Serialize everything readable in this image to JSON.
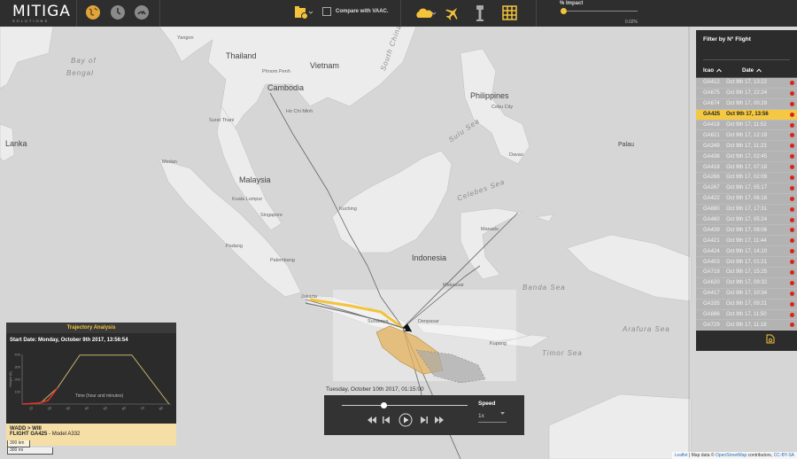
{
  "app": {
    "name": "MITIGA",
    "subtitle": "SOLUTIONS"
  },
  "toolbar": {
    "icons": [
      "globe-icon",
      "clock-icon",
      "gauge-icon",
      "volcano-layer-icon",
      "cloud-icon",
      "airplane-icon",
      "tower-icon",
      "grid-icon"
    ],
    "compare_label": "Compare with VAAC.",
    "impact_label": "% Impact",
    "impact_value": "0.02%",
    "impact_fraction": 0.0002
  },
  "map": {
    "countries": [
      "Thailand",
      "Vietnam",
      "Cambodia",
      "Philippines",
      "Malaysia",
      "Indonesia",
      "Lanka",
      "Palau"
    ],
    "seas": [
      "Bay of",
      "Bengal",
      "South China Sea",
      "Sulu Sea",
      "Celebes Sea",
      "Banda Sea",
      "Arafura Sea",
      "Timor Sea"
    ],
    "cities": [
      "Yangon",
      "Surat Thani",
      "Kuala Lumpur",
      "Singapore",
      "Palembang",
      "Jakarta",
      "Surabaya",
      "Denpasar",
      "Makassar",
      "Kupang",
      "Manado",
      "Kuching",
      "Ho Chi Minh",
      "Phnom Penh",
      "Medan",
      "Padang",
      "Cebu City",
      "Davao"
    ],
    "scale_km": "300 km",
    "scale_mi": "300 mi",
    "attribution_leaflet": "Leaflet",
    "attribution_text": " | Map data © ",
    "attribution_osm": "OpenStreetMap",
    "attribution_contrib": " contributors, ",
    "attribution_license": "CC-BY-SA"
  },
  "flight_panel": {
    "title": "Filter by N° Flight",
    "col_icao": "Icao",
    "col_date": "Date",
    "sort_icon": "chevron-up-icon",
    "rows": [
      {
        "icao": "GA412",
        "date": "Oct 9th 17, 13:22",
        "active": false
      },
      {
        "icao": "GA675",
        "date": "Oct 9th 17, 22:24",
        "active": false
      },
      {
        "icao": "GA674",
        "date": "Oct 9th 17, 00:29",
        "active": false
      },
      {
        "icao": "GA425",
        "date": "Oct 9th 17, 13:56",
        "active": true
      },
      {
        "icao": "GA418",
        "date": "Oct 9th 17, 11:52",
        "active": false
      },
      {
        "icao": "GA621",
        "date": "Oct 9th 17, 12:19",
        "active": false
      },
      {
        "icao": "GA349",
        "date": "Oct 9th 17, 11:23",
        "active": false
      },
      {
        "icao": "GA438",
        "date": "Oct 9th 17, 02:45",
        "active": false
      },
      {
        "icao": "GA418",
        "date": "Oct 9th 17, 07:18",
        "active": false
      },
      {
        "icao": "GA266",
        "date": "Oct 9th 17, 02:09",
        "active": false
      },
      {
        "icao": "GA267",
        "date": "Oct 9th 17, 05:17",
        "active": false
      },
      {
        "icao": "GA422",
        "date": "Oct 9th 17, 06:18",
        "active": false
      },
      {
        "icao": "GA880",
        "date": "Oct 9th 17, 17:31",
        "active": false
      },
      {
        "icao": "GA460",
        "date": "Oct 9th 17, 05:24",
        "active": false
      },
      {
        "icao": "GA439",
        "date": "Oct 9th 17, 08:06",
        "active": false
      },
      {
        "icao": "GA421",
        "date": "Oct 9th 17, 11:44",
        "active": false
      },
      {
        "icao": "GA424",
        "date": "Oct 9th 17, 14:10",
        "active": false
      },
      {
        "icao": "GA403",
        "date": "Oct 9th 17, 01:21",
        "active": false
      },
      {
        "icao": "GA718",
        "date": "Oct 9th 17, 15:25",
        "active": false
      },
      {
        "icao": "GA620",
        "date": "Oct 9th 17, 09:32",
        "active": false
      },
      {
        "icao": "GA417",
        "date": "Oct 9th 17, 10:34",
        "active": false
      },
      {
        "icao": "GA335",
        "date": "Oct 9th 17, 09:21",
        "active": false
      },
      {
        "icao": "GA886",
        "date": "Oct 9th 17, 11:50",
        "active": false
      },
      {
        "icao": "GA729",
        "date": "Oct 9th 17, 11:18",
        "active": false
      }
    ]
  },
  "trajectory": {
    "title": "Trajectory Analysis",
    "start_date": "Start Date: Monday, October 9th 2017, 13:56:54",
    "xlabel": "Time (hour and minutes)",
    "ylabel": "Height (ft)",
    "route": "WADD > WIII",
    "flight_prefix": "FLIGHT ",
    "flight_code": "GA425",
    "flight_model": " - Model A332"
  },
  "chart_data": {
    "type": "line",
    "title": "",
    "xlabel": "Time (hour and minutes)",
    "ylabel": "Height (ft)",
    "y_ticks": [
      "400",
      "300",
      "200",
      "100"
    ],
    "x_ticks": [
      "10",
      "20",
      "30",
      "40",
      "50",
      "60",
      "70",
      "80"
    ],
    "ylim": [
      0,
      400
    ],
    "xlim": [
      5,
      85
    ],
    "series": [
      {
        "color": "#c8b56a",
        "points": [
          [
            5,
            0
          ],
          [
            15,
            10
          ],
          [
            24,
            130
          ],
          [
            36,
            395
          ],
          [
            64,
            395
          ],
          [
            84,
            0
          ]
        ]
      },
      {
        "color": "#e0332a",
        "points": [
          [
            5,
            0
          ],
          [
            14,
            8
          ],
          [
            19,
            30
          ],
          [
            24,
            130
          ]
        ]
      }
    ]
  },
  "player": {
    "timestamp": "Tuesday, October 10th 2017, 01:15:00",
    "speed_label": "Speed",
    "speed_value": "1x",
    "progress": 0.33
  },
  "colors": {
    "accent": "#f3c33b",
    "selected_row": "#f4c842",
    "status_dot": "#d9261c",
    "panel_bg": "#2c2c2c"
  }
}
